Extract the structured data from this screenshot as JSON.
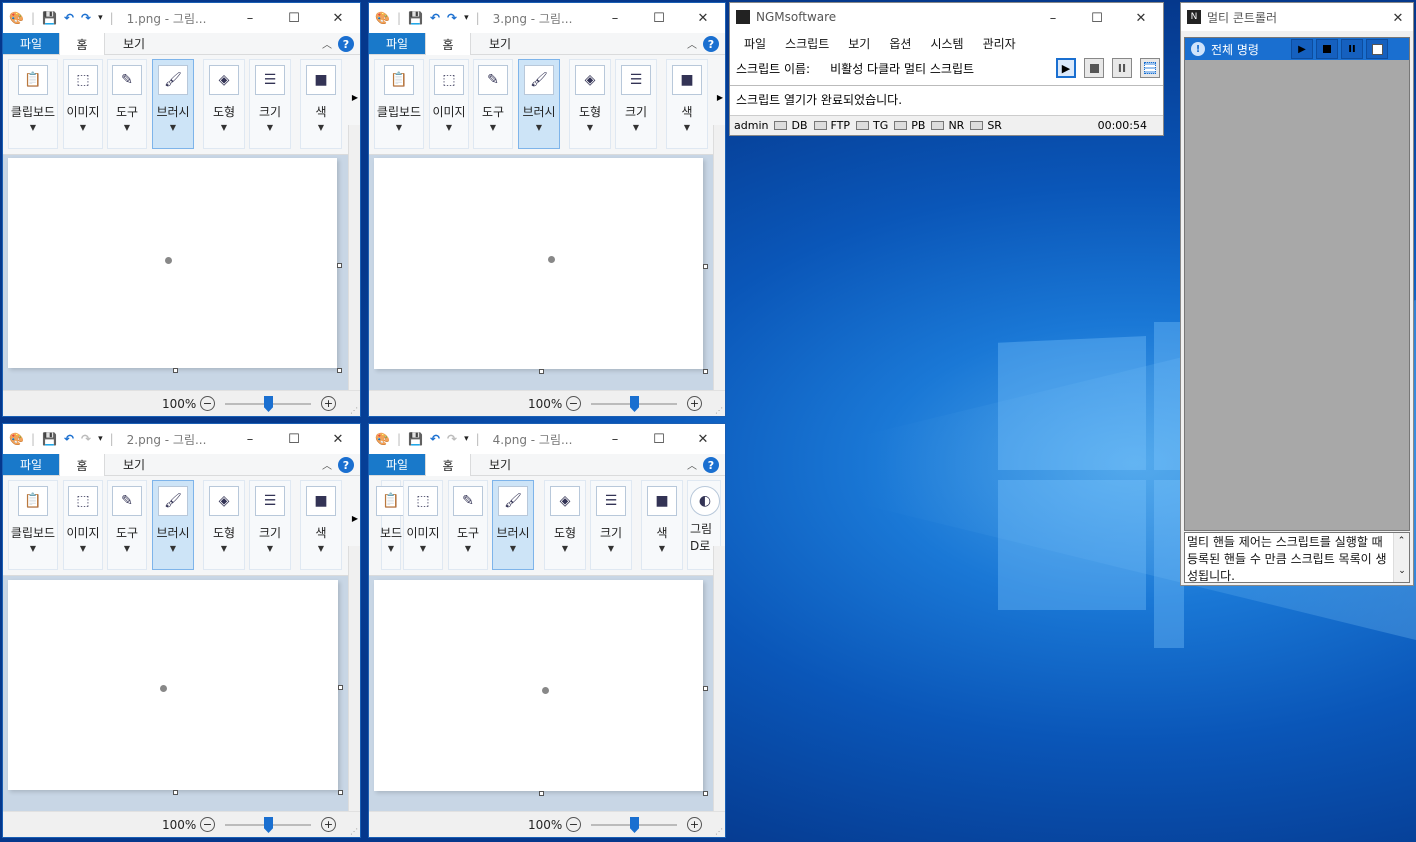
{
  "paint_windows": [
    {
      "title": "1.png - 그림...",
      "zoom": "100%",
      "zoom_level": 0.5
    },
    {
      "title": "3.png - 그림...",
      "zoom": "100%",
      "zoom_level": 0.5
    },
    {
      "title": "2.png - 그림...",
      "zoom": "100%",
      "zoom_level": 0.5
    },
    {
      "title": "4.png - 그림...",
      "zoom": "100%",
      "zoom_level": 0.5
    }
  ],
  "paint_tabs": {
    "file": "파일",
    "home": "홈",
    "view": "보기"
  },
  "paint_groups": {
    "clipboard": "클립보드",
    "image": "이미지",
    "tools": "도구",
    "brush": "브러시",
    "shapes": "도형",
    "size": "크기",
    "color": "색",
    "clipboard_partial": "보드",
    "paint3d_a": "그림",
    "paint3d_b": "D로"
  },
  "ngm": {
    "title": "NGMsoftware",
    "menu": [
      "파일",
      "스크립트",
      "보기",
      "옵션",
      "시스템",
      "관리자"
    ],
    "script_name_label": "스크립트 이름:",
    "script_name": "비활성 다클라 멀티 스크립트",
    "message": "스크립트 열기가 완료되었습니다.",
    "status_user": "admin",
    "indicators": [
      "DB",
      "FTP",
      "TG",
      "PB",
      "NR",
      "SR"
    ],
    "elapsed": "00:00:54"
  },
  "multi": {
    "title": "멀티 콘트롤러",
    "row_label": "전체 명령",
    "description": "멀티 핸들 제어는 스크립트를 실행할 때 등록된 핸들 수 만큼 스크립트 목록이 생성됩니다."
  },
  "colors": {
    "accent": "#1a6fd0",
    "file_tab": "#1979ca"
  },
  "icons": {
    "window_controls": [
      "minimize-icon",
      "maximize-icon",
      "close-icon"
    ],
    "player": [
      "play-icon",
      "stop-icon",
      "pause-icon",
      "grid-icon"
    ]
  }
}
